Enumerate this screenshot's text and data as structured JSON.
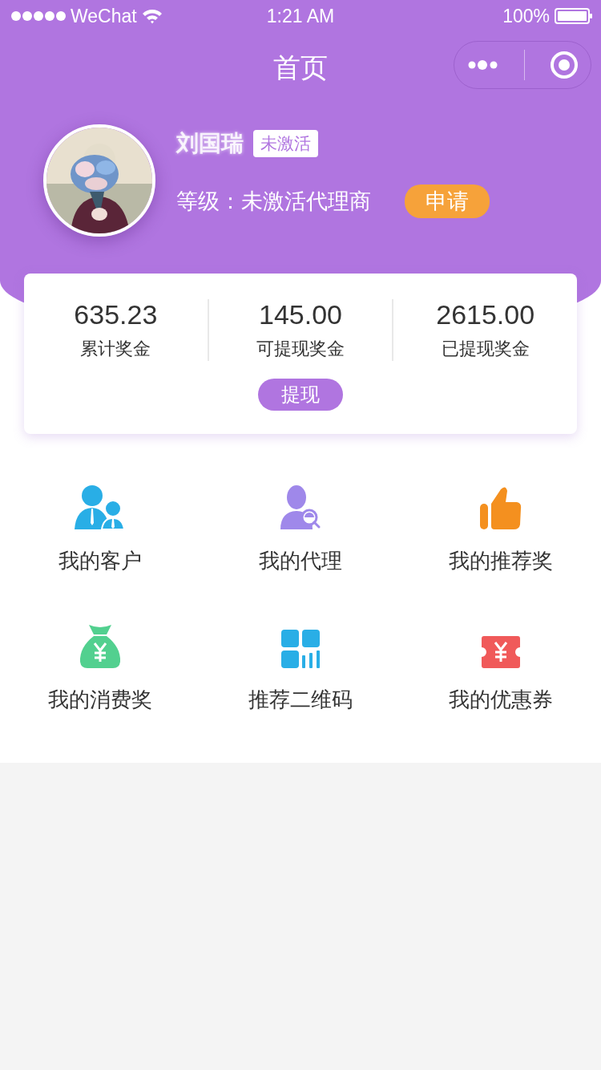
{
  "status_bar": {
    "carrier": "WeChat",
    "time": "1:21 AM",
    "battery": "100%"
  },
  "nav": {
    "title": "首页"
  },
  "profile": {
    "name": "刘国瑞",
    "badge": "未激活",
    "level": "等级：未激活代理商",
    "apply_button": "申请"
  },
  "stats": [
    {
      "value": "635.23",
      "label": "累计奖金"
    },
    {
      "value": "145.00",
      "label": "可提现奖金"
    },
    {
      "value": "2615.00",
      "label": "已提现奖金"
    }
  ],
  "withdraw_button": "提现",
  "menu": [
    {
      "kind": "customers",
      "label": "我的客户"
    },
    {
      "kind": "agents",
      "label": "我的代理"
    },
    {
      "kind": "referral",
      "label": "我的推荐奖"
    },
    {
      "kind": "spending",
      "label": "我的消费奖"
    },
    {
      "kind": "qrcode",
      "label": "推荐二维码"
    },
    {
      "kind": "coupon",
      "label": "我的优惠券"
    }
  ]
}
